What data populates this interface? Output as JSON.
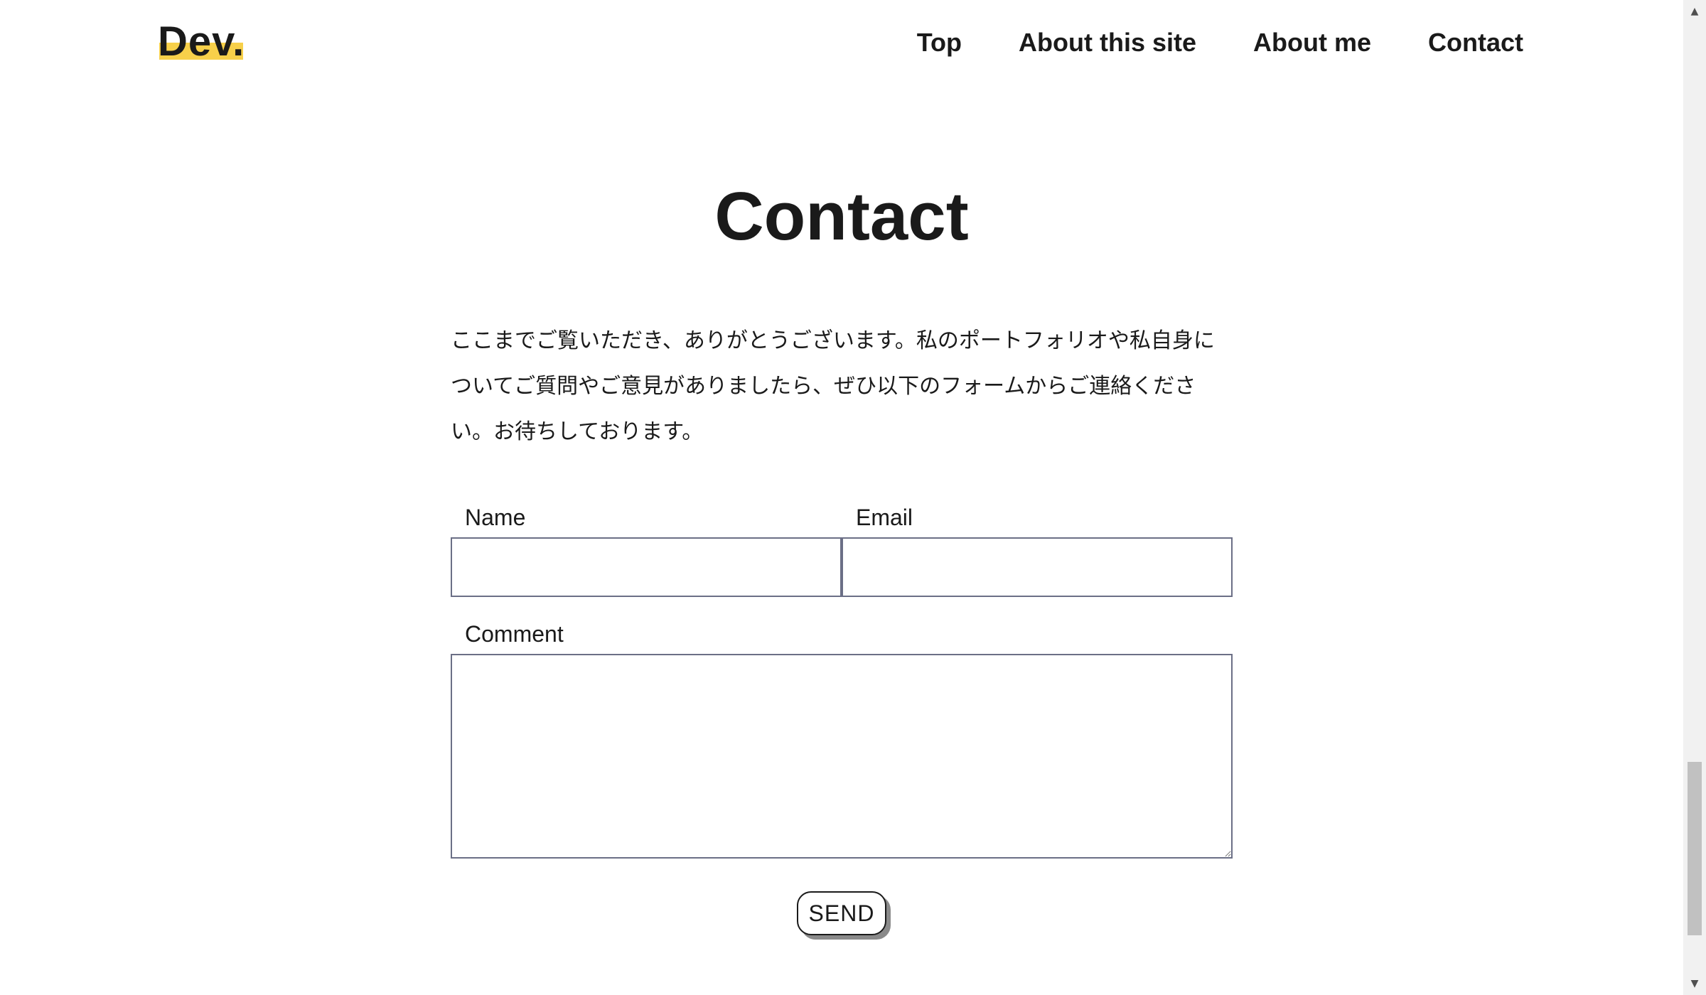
{
  "header": {
    "logo": "Dev.",
    "nav": [
      {
        "label": "Top"
      },
      {
        "label": "About this site"
      },
      {
        "label": "About me"
      },
      {
        "label": "Contact"
      }
    ]
  },
  "main": {
    "title": "Contact",
    "intro": "ここまでご覧いただき、ありがとうございます。私のポートフォリオや私自身についてご質問やご意見がありましたら、ぜひ以下のフォームからご連絡ください。お待ちしております。"
  },
  "form": {
    "name_label": "Name",
    "name_value": "",
    "email_label": "Email",
    "email_value": "",
    "comment_label": "Comment",
    "comment_value": "",
    "send_label": "SEND"
  },
  "colors": {
    "logo_accent": "#f7d04a",
    "text": "#1a1a1a",
    "input_border": "#6b6f86"
  },
  "scrollbar": {
    "up_icon": "triangle-up-icon",
    "down_icon": "triangle-down-icon"
  }
}
